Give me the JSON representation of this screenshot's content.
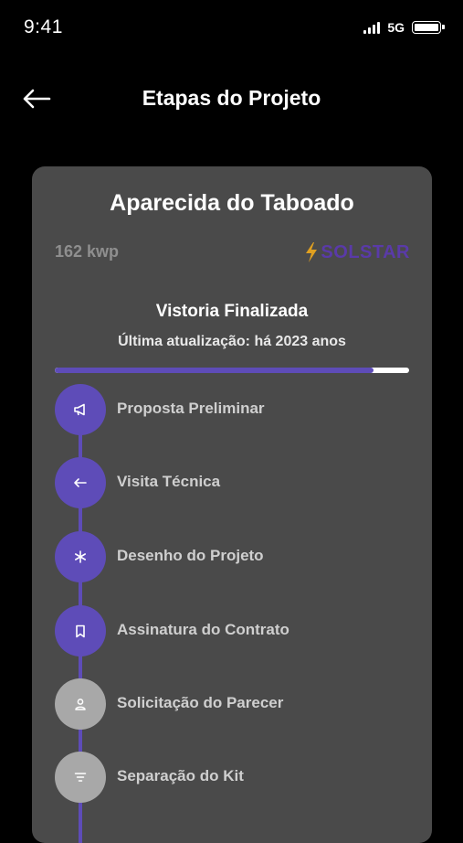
{
  "status_bar": {
    "time": "9:41",
    "network": "5G"
  },
  "header": {
    "title": "Etapas do Projeto",
    "back_icon": "arrow-left-icon"
  },
  "project": {
    "name": "Aparecida do Taboado",
    "power": "162 kwp",
    "brand": "SOLSTAR",
    "status": "Vistoria Finalizada",
    "last_update": "Última atualização: há 2023 anos",
    "progress_percent": 90
  },
  "steps": [
    {
      "label": "Proposta Preliminar",
      "icon": "megaphone-icon",
      "done": true
    },
    {
      "label": "Visita Técnica",
      "icon": "arrow-left-icon",
      "done": true
    },
    {
      "label": "Desenho do Projeto",
      "icon": "asterisk-icon",
      "done": true
    },
    {
      "label": "Assinatura do Contrato",
      "icon": "bookmark-icon",
      "done": true
    },
    {
      "label": "Solicitação do Parecer",
      "icon": "user-icon",
      "done": false
    },
    {
      "label": "Separação do Kit",
      "icon": "filter-icon",
      "done": false
    }
  ],
  "colors": {
    "accent": "#5e4cb8",
    "card": "#4a4a4a",
    "pending": "#a8a8a8",
    "background": "#000000"
  }
}
